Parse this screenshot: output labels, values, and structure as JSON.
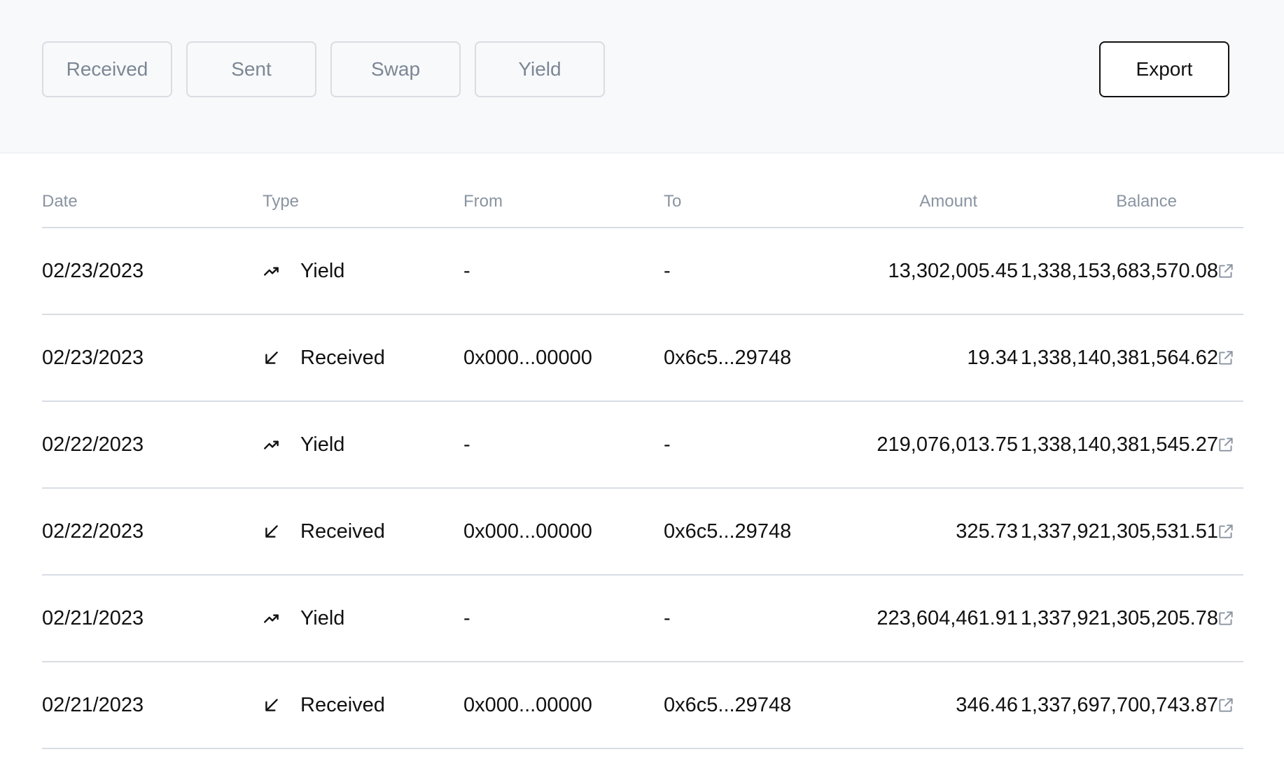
{
  "filters": [
    "Received",
    "Sent",
    "Swap",
    "Yield"
  ],
  "export_label": "Export",
  "columns": {
    "date": "Date",
    "type": "Type",
    "from": "From",
    "to": "To",
    "amount": "Amount",
    "balance": "Balance"
  },
  "rows": [
    {
      "date": "02/23/2023",
      "type": "Yield",
      "icon": "trending-up-icon",
      "from": "-",
      "to": "-",
      "amount": "13,302,005.45",
      "balance": "1,338,153,683,570.08"
    },
    {
      "date": "02/23/2023",
      "type": "Received",
      "icon": "arrow-down-left-icon",
      "from": "0x000...00000",
      "to": "0x6c5...29748",
      "amount": "19.34",
      "balance": "1,338,140,381,564.62"
    },
    {
      "date": "02/22/2023",
      "type": "Yield",
      "icon": "trending-up-icon",
      "from": "-",
      "to": "-",
      "amount": "219,076,013.75",
      "balance": "1,338,140,381,545.27"
    },
    {
      "date": "02/22/2023",
      "type": "Received",
      "icon": "arrow-down-left-icon",
      "from": "0x000...00000",
      "to": "0x6c5...29748",
      "amount": "325.73",
      "balance": "1,337,921,305,531.51"
    },
    {
      "date": "02/21/2023",
      "type": "Yield",
      "icon": "trending-up-icon",
      "from": "-",
      "to": "-",
      "amount": "223,604,461.91",
      "balance": "1,337,921,305,205.78"
    },
    {
      "date": "02/21/2023",
      "type": "Received",
      "icon": "arrow-down-left-icon",
      "from": "0x000...00000",
      "to": "0x6c5...29748",
      "amount": "346.46",
      "balance": "1,337,697,700,743.87"
    }
  ]
}
